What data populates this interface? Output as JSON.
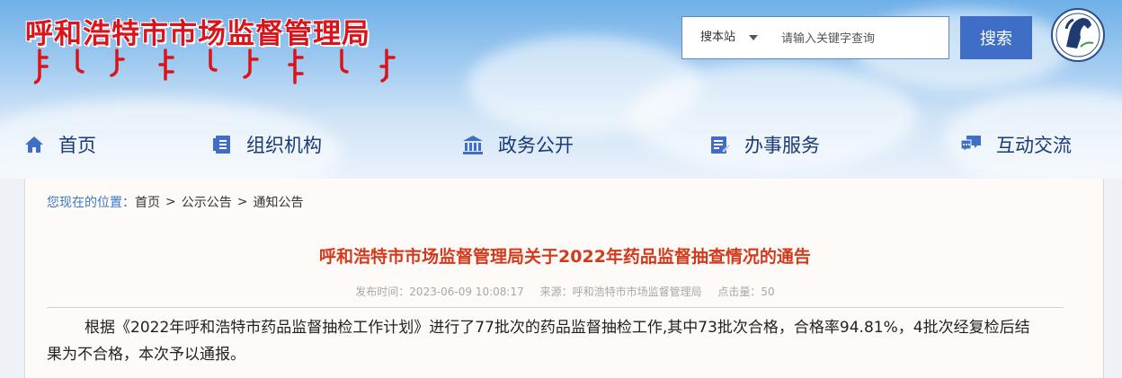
{
  "header": {
    "site_title": "呼和浩特市市场监督管理局"
  },
  "search": {
    "scope_label": "搜本站",
    "placeholder": "请输入关键字查询",
    "button_label": "搜索"
  },
  "nav": {
    "items": [
      {
        "label": "首页",
        "icon": "home-icon"
      },
      {
        "label": "组织机构",
        "icon": "organization-icon"
      },
      {
        "label": "政务公开",
        "icon": "government-building-icon"
      },
      {
        "label": "办事服务",
        "icon": "service-form-icon"
      },
      {
        "label": "互动交流",
        "icon": "chat-icon"
      }
    ]
  },
  "breadcrumb": {
    "label": "您现在的位置：",
    "items": [
      "首页",
      "公示公告",
      "通知公告"
    ],
    "separator": ">"
  },
  "article": {
    "title": "呼和浩特市市场监督管理局关于2022年药品监督抽查情况的通告",
    "publish_time": "发布时间：2023-06-09 10:08:17",
    "source": "来源：呼和浩特市市场监督管理局",
    "clicks": "点击量：50",
    "body": "根据《2022年呼和浩特市药品监督抽检工作计划》进行了77批次的药品监督抽检工作,其中73批次合格，合格率94.81%，4批次经复检后结果为不合格，本次予以通报。"
  },
  "colors": {
    "title_red": "#d9141b",
    "nav_blue": "#1c3a78",
    "search_blue": "#3e6ec6",
    "article_title": "#d23a1e"
  }
}
